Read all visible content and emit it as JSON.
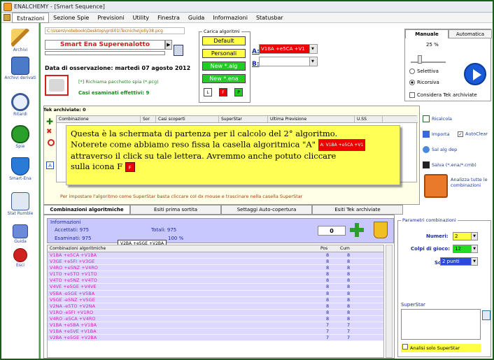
{
  "window": {
    "title": "ENALCHEMY - [Smart Sequence]"
  },
  "menu": [
    "Estrazioni",
    "Sezione Spie",
    "Previsioni",
    "Utility",
    "Finestra",
    "Guida",
    "Informazioni",
    "Statusbar"
  ],
  "sidebar": [
    {
      "label": "Archivi",
      "icon": "pencil-icon"
    },
    {
      "label": "Archivi derivati",
      "icon": "archive-icon"
    },
    {
      "label": "Ritardi",
      "icon": "clock-icon"
    },
    {
      "label": "Spie",
      "icon": "spy-pill-icon"
    },
    {
      "label": "Smart-Ena",
      "icon": "shield-icon"
    },
    {
      "label": "Stat Rumble",
      "icon": "network-icon"
    },
    {
      "label": "Guida",
      "icon": "book-icon"
    },
    {
      "label": "Esci",
      "icon": "power-icon"
    }
  ],
  "top": {
    "path": "C:\\Users\\notebook\\Desktop\\grdi01\\Tecniche\\jolly38.pcg",
    "game": "Smart Ena Superenalotto",
    "date_label": "Data di osservazione:",
    "date_value": "martedì 07 agosto 2012",
    "richiama": "[*] Richiama pacchetto spia (*.pcg)",
    "casi": "Casi esaminati effettivi: 9"
  },
  "carica": {
    "legend": "Carica algoritmi",
    "btn_default": "Default",
    "btn_personali": "Personali",
    "btn_new_alg": "New *.alg",
    "btn_new_ena": "New *.ena",
    "sq_l": "L",
    "sq_f": "F",
    "sq_p": "P"
  },
  "algo": {
    "a_label": "A:",
    "a_value": "V1BA +e5CA +V1",
    "b_label": "B:",
    "b_value": ""
  },
  "mode_tabs": {
    "tab_manuale": "Manuale",
    "tab_automatica": "Automatica",
    "percent": "25 %",
    "selettiva": "Selettiva",
    "ricorsiva": "Ricorsiva",
    "considera": "Considera Tek archiviate"
  },
  "tek": {
    "header": "Tek archiviate: 0",
    "columns": [
      "Combinazione",
      "Sor",
      "Casi scoperti",
      "SuperStar",
      "Ultima Previsione",
      "U.SS"
    ],
    "a_button": "A",
    "note": "Per impostare l'algoritmo come SuperStar basta cliccare col dx mouse e trascinare nella casella SuperStar"
  },
  "tooltip": {
    "line1": "Questa è la schermata di partenza per il calcolo del 2° algoritmo.",
    "line2a": "Noterete come abbiamo reso fissa la casella algoritmica \"A\"",
    "a_tag_letter": "A:",
    "a_tag_value": "V1BA +e5CA +V1",
    "line3": "attraverso il click su tale lettera. Avremmo anche potuto cliccare",
    "line4": "sulla icona F",
    "f_icon": "F"
  },
  "right_actions": {
    "ricalcola": "Ricalcola",
    "importa": "Importa",
    "autoclear": "AutoClear",
    "salva_alg": "Sal alg dep",
    "salva_ena": "Salva (*.ena/*.cmb)",
    "analizza": "Analizza tutte le combinazioni"
  },
  "bottom_tabs": [
    "Combinazioni algoritmiche",
    "Esiti prima sortita",
    "Settaggi Auto-copertura",
    "Esiti Tek archiviate"
  ],
  "info": {
    "title": "Informazioni",
    "accettati_label": "Accettati:",
    "accettati": "975",
    "esaminati_label": "Esaminati:",
    "esaminati": "975",
    "totali_label": "Totali:",
    "totali": "975",
    "percent": "100 %",
    "counter": "0",
    "hover_tip": "V2BA +e5GE +V2BA"
  },
  "list": {
    "columns": [
      "Combinazioni algoritmiche",
      "Pos",
      "Cum"
    ],
    "rows": [
      [
        "V1BA +e5CA +V1BA",
        "8",
        "8"
      ],
      [
        "V3GE +e5FI +V3GE",
        "8",
        "8"
      ],
      [
        "V4RO +e5NZ +V4RO",
        "8",
        "8"
      ],
      [
        "V1TO +e5TO +V1TO",
        "8",
        "8"
      ],
      [
        "V4TO +e5NZ +V4TO",
        "8",
        "8"
      ],
      [
        "V4VE +e5GE +V4VE",
        "8",
        "8"
      ],
      [
        "V5BA -e5GE +V5BA",
        "8",
        "8"
      ],
      [
        "V5GE -e5NZ +V5GE",
        "8",
        "8"
      ],
      [
        "V2NA -e5TO +V2NA",
        "8",
        "8"
      ],
      [
        "V1RO -e5FI +V1RO",
        "8",
        "8"
      ],
      [
        "V4RO -e5CA +V4RO",
        "8",
        "8"
      ],
      [
        "V1BA +e5BA +V1BA",
        "7",
        "7"
      ],
      [
        "V1BA +e5VE +V1BA",
        "7",
        "7"
      ],
      [
        "V2BA +e5GE +V2BA",
        "7",
        "7"
      ]
    ]
  },
  "params": {
    "legend": "Parametri combinazioni",
    "numeri_label": "Numeri:",
    "numeri": "2",
    "colpi_label": "Colpi di gioco:",
    "colpi": "12",
    "sorte_label": "Sorte:",
    "sorte": "2 punti",
    "superstar_label": "SuperStar",
    "analisi_solo": "Analisi solo SuperStar"
  },
  "colors": {
    "accent_red": "#e00000",
    "bg_green": "#4f9a4f",
    "yellow": "#ffff55",
    "list_bg": "#ddd8ff"
  }
}
